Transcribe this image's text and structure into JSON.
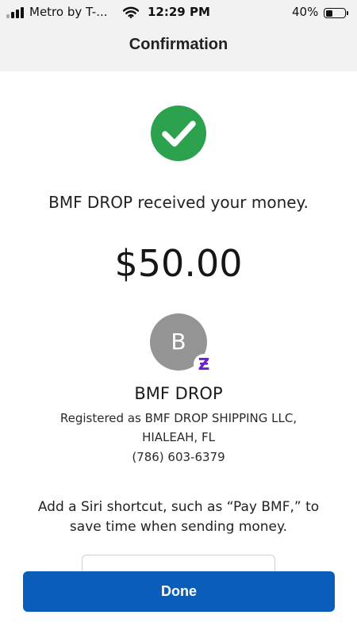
{
  "status_bar": {
    "carrier": "Metro by T-...",
    "time": "12:29 PM",
    "battery_percent": "40%",
    "battery_level": 0.4,
    "wifi_icon": "wifi-icon",
    "signal_icon": "cellular-signal-icon"
  },
  "header": {
    "title": "Confirmation"
  },
  "confirmation": {
    "success_icon": "checkmark-circle-icon",
    "message": "BMF DROP received your money.",
    "amount": "$50.00"
  },
  "payee": {
    "avatar_initial": "B",
    "badge_glyph": "Ƶ",
    "badge_icon": "zelle-badge-icon",
    "name": "BMF DROP",
    "registered_line_1": "Registered as BMF DROP SHIPPING LLC,",
    "registered_line_2": "HIALEAH, FL",
    "phone": "(786) 603-6379"
  },
  "siri": {
    "text": "Add a Siri shortcut, such as “Pay BMF,” to save time when sending money."
  },
  "footer": {
    "done_label": "Done"
  },
  "colors": {
    "success_green": "#2ca14e",
    "primary_blue": "#0a5eba",
    "zelle_purple": "#6d1ed4",
    "avatar_gray": "#949494"
  }
}
